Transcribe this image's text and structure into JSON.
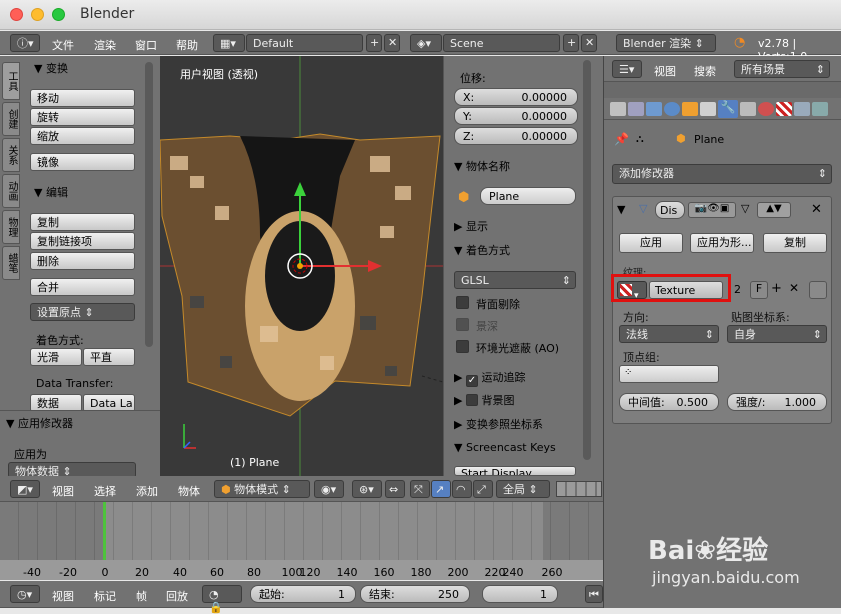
{
  "window": {
    "title": "Blender"
  },
  "top_header": {
    "menus": [
      "文件",
      "渲染",
      "窗口",
      "帮助"
    ],
    "layout": "Default",
    "scene": "Scene",
    "engine": "Blender 渲染",
    "version": "v2.78 | Verts:1,0"
  },
  "tool_shelf": {
    "tabs": [
      "工具",
      "创建",
      "关系",
      "动画",
      "物理",
      "蜡笔"
    ],
    "transform": {
      "title": "变换",
      "buttons": [
        "移动",
        "旋转",
        "缩放",
        "镜像"
      ]
    },
    "edit": {
      "title": "编辑",
      "buttons": [
        "复制",
        "复制链接项",
        "删除",
        "合并"
      ],
      "set_origin": "设置原点",
      "shading_label": "着色方式:",
      "smooth": "光滑",
      "flat": "平直",
      "data_transfer_label": "Data Transfer:",
      "data": "数据",
      "data_layers": "Data La"
    },
    "apply_modifier": {
      "title": "应用修改器",
      "apply_as_label": "应用为",
      "apply_as_value": "物体数据"
    }
  },
  "viewport": {
    "label": "用户视图 (透视)",
    "object_label": "(1) Plane"
  },
  "properties_panel": {
    "location_label": "位移:",
    "x_label": "X:",
    "x": "0.00000",
    "y_label": "Y:",
    "y": "0.00000",
    "z_label": "Z:",
    "z": "0.00000",
    "item_title": "物体名称",
    "object_name": "Plane",
    "display": "显示",
    "shading": "着色方式",
    "shading_mode": "GLSL",
    "backface": "背面剔除",
    "dof": "景深",
    "ao": "环境光遮蔽 (AO)",
    "motion_tracking": "运动追踪",
    "background": "背景图",
    "transform_orientations": "变换参照坐标系",
    "screencast": "Screencast Keys",
    "start_display": "Start Display"
  },
  "viewport_header": {
    "view": "视图",
    "select": "选择",
    "add": "添加",
    "object": "物体",
    "mode": "物体模式",
    "orientation": "全局"
  },
  "timeline": {
    "ticks": [
      "-40",
      "-20",
      "0",
      "20",
      "40",
      "60",
      "80",
      "100",
      "120",
      "140",
      "160",
      "180",
      "200",
      "220",
      "240",
      "260"
    ],
    "view": "视图",
    "marker": "标记",
    "frame": "帧",
    "playback": "回放",
    "start_label": "起始:",
    "start": "1",
    "end_label": "结束:",
    "end": "250",
    "current": "1"
  },
  "right_panel": {
    "view": "视图",
    "search": "搜索",
    "filter": "所有场景",
    "breadcrumb": "Plane",
    "add_modifier": "添加修改器",
    "modifier_name": "Dis",
    "apply": "应用",
    "apply_as_shape": "应用为形...",
    "copy": "复制",
    "texture_label": "纹理:",
    "texture": "Texture",
    "users": "2",
    "fake": "F",
    "direction_label": "方向:",
    "direction": "法线",
    "coords_label": "贴图坐标系:",
    "coords": "自身",
    "vgroup_label": "顶点组:",
    "midlevel_label": "中间值:",
    "midlevel": "0.500",
    "strength_label": "强度/:",
    "strength": "1.000"
  },
  "watermark": {
    "brand": "Bai",
    "brand2": "经验",
    "url": "jingyan.baidu.com"
  },
  "colors": {
    "highlight": "#e0100f",
    "accent": "#5680c2"
  }
}
